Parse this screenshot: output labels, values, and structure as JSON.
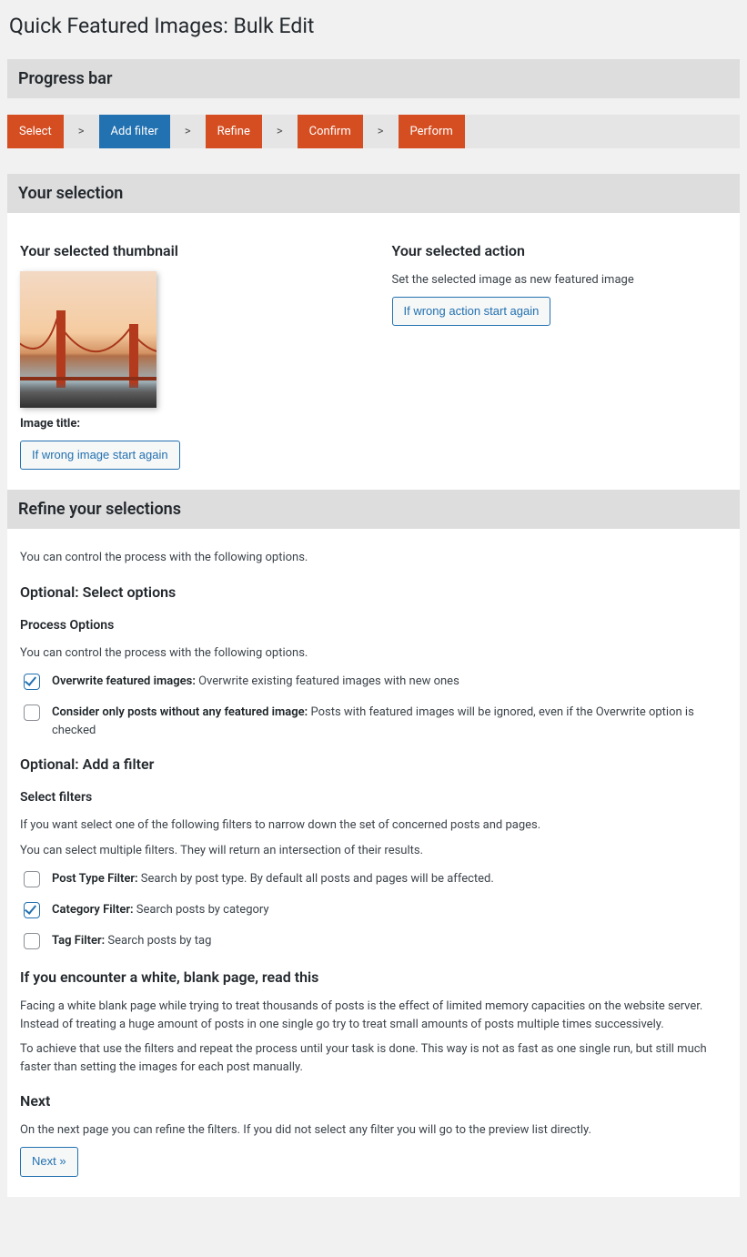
{
  "page_title": "Quick Featured Images: Bulk Edit",
  "progress": {
    "heading": "Progress bar",
    "steps": [
      "Select",
      "Add filter",
      "Refine",
      "Confirm",
      "Perform"
    ],
    "active_index": 1,
    "separator": ">"
  },
  "selection": {
    "heading": "Your selection",
    "thumb_heading": "Your selected thumbnail",
    "image_title_label": "Image title:",
    "wrong_image_btn": "If wrong image start again",
    "action_heading": "Your selected action",
    "action_desc": "Set the selected image as new featured image",
    "wrong_action_btn": "If wrong action start again"
  },
  "refine": {
    "heading": "Refine your selections",
    "intro": "You can control the process with the following options.",
    "options_heading": "Optional: Select options",
    "process_options_heading": "Process Options",
    "process_options_intro": "You can control the process with the following options.",
    "opt_overwrite": {
      "label": "Overwrite featured images:",
      "desc": "Overwrite existing featured images with new ones",
      "checked": true
    },
    "opt_only_without": {
      "label": "Consider only posts without any featured image:",
      "desc": "Posts with featured images will be ignored, even if the Overwrite option is checked",
      "checked": false
    },
    "filter_heading": "Optional: Add a filter",
    "select_filters_heading": "Select filters",
    "filters_intro1": "If you want select one of the following filters to narrow down the set of concerned posts and pages.",
    "filters_intro2": "You can select multiple filters. They will return an intersection of their results.",
    "filter_post_type": {
      "label": "Post Type Filter:",
      "desc": "Search by post type. By default all posts and pages will be affected.",
      "checked": false
    },
    "filter_category": {
      "label": "Category Filter:",
      "desc": "Search posts by category",
      "checked": true
    },
    "filter_tag": {
      "label": "Tag Filter:",
      "desc": "Search posts by tag",
      "checked": false
    },
    "blank_heading": "If you encounter a white, blank page, read this",
    "blank_p1": "Facing a white blank page while trying to treat thousands of posts is the effect of limited memory capacities on the website server. Instead of treating a huge amount of posts in one single go try to treat small amounts of posts multiple times successively.",
    "blank_p2": "To achieve that use the filters and repeat the process until your task is done. This way is not as fast as one single run, but still much faster than setting the images for each post manually.",
    "next_heading": "Next",
    "next_desc": "On the next page you can refine the filters. If you did not select any filter you will go to the preview list directly.",
    "next_btn": "Next »"
  }
}
